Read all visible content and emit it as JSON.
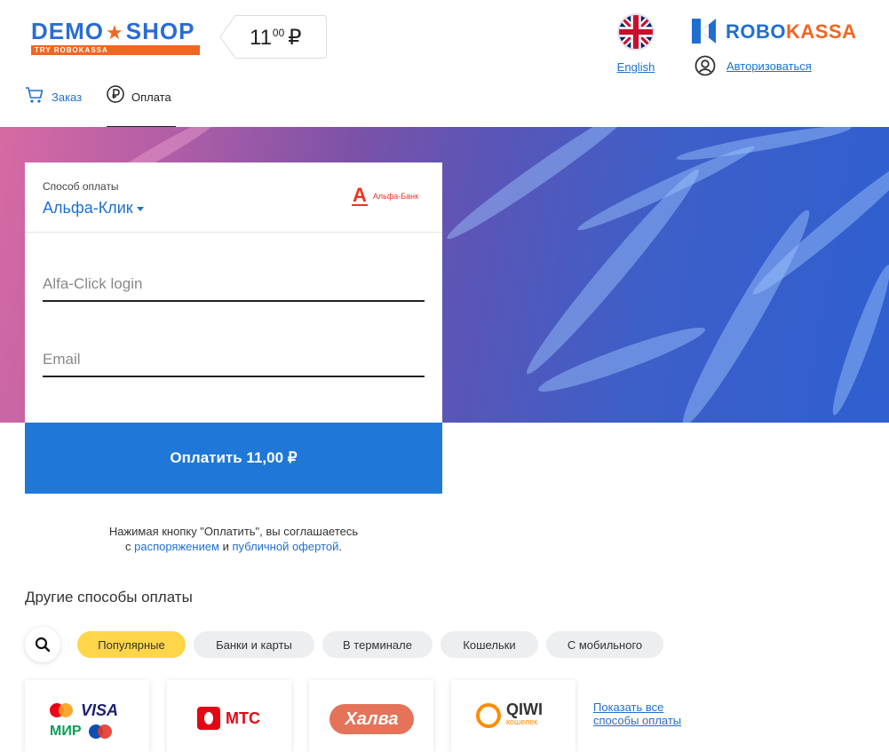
{
  "header": {
    "shop_logo": {
      "word_left": "DEMO",
      "word_right": "SHOP",
      "tagline": "TRY ROBOKASSA"
    },
    "price": {
      "main": "11",
      "cents": "00",
      "currency": "₽"
    },
    "language": {
      "label": "English",
      "icon": "uk-flag-icon"
    },
    "brand": {
      "part1": "ROBO",
      "part2": "KASSA"
    },
    "login": {
      "label": "Авторизоваться",
      "icon": "user-circle-icon"
    }
  },
  "tabs": [
    {
      "label": "Заказ",
      "icon": "cart-icon"
    },
    {
      "label": "Оплата",
      "icon": "ruble-circle-icon"
    }
  ],
  "payment_form": {
    "method_caption": "Способ оплаты",
    "method_value": "Альфа-Клик",
    "bank_logo": {
      "letter": "А",
      "text": "Альфа-Банк"
    },
    "login_placeholder": "Alfa-Click login",
    "email_placeholder": "Email",
    "pay_button": "Оплатить 11,00 ₽"
  },
  "agreement": {
    "line1": "Нажимая кнопку \"Оплатить\", вы соглашаетесь",
    "prefix": "с",
    "link1": "распоряжением",
    "conj": "и",
    "link2": "публичной офертой",
    "suffix": "."
  },
  "other_methods": {
    "title": "Другие способы оплаты",
    "search_icon": "search-icon",
    "filters": [
      "Популярные",
      "Банки и карты",
      "В терминале",
      "Кошельки",
      "С мобильного"
    ],
    "active_filter": "Популярные",
    "tiles": {
      "cards": {
        "visa": "VISA",
        "mir": "МИР"
      },
      "mts": "МТС",
      "halva": "Халва",
      "qiwi": {
        "name": "QIWI",
        "sub": "кошелек"
      }
    },
    "show_all": "Показать все способы оплаты"
  },
  "colors": {
    "accent": "#1f78d8",
    "link": "#1f6fd0",
    "brand_orange": "#f26522",
    "active_chip": "#ffd54a",
    "alfa_red": "#ef3124"
  }
}
